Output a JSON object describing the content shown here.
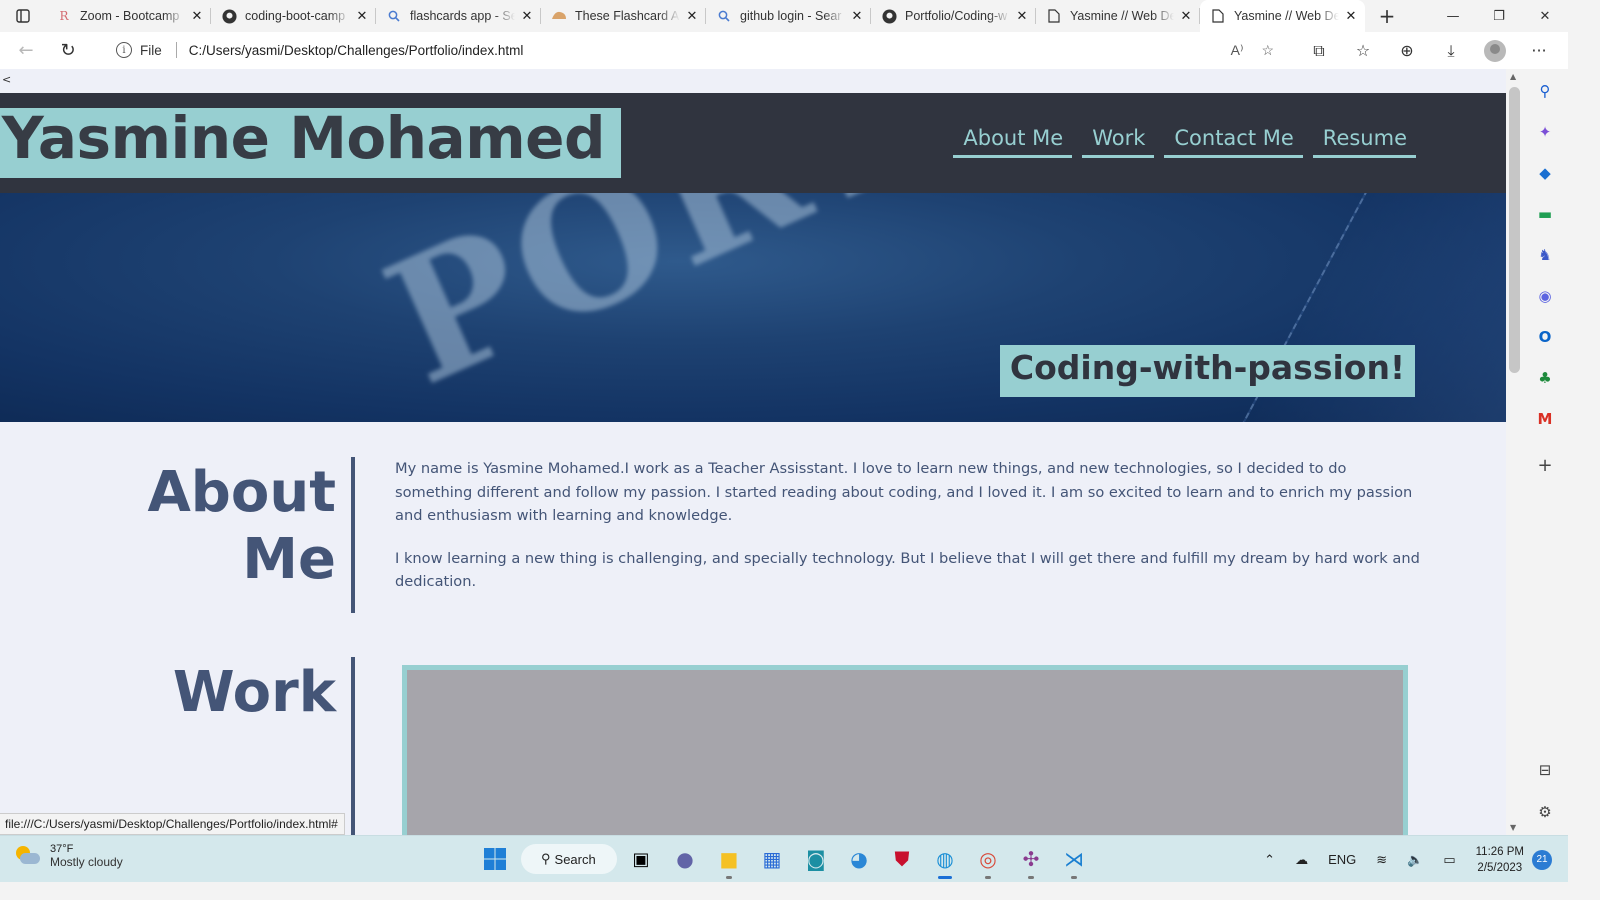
{
  "browser": {
    "tabs": [
      {
        "label": "Zoom - Bootcamp",
        "icon": "rss-icon"
      },
      {
        "label": "coding-boot-camp",
        "icon": "github-icon"
      },
      {
        "label": "flashcards app - Se",
        "icon": "search-icon"
      },
      {
        "label": "These Flashcard Ap",
        "icon": "site-icon"
      },
      {
        "label": "github login - Sear",
        "icon": "search-icon"
      },
      {
        "label": "Portfolio/Coding-w",
        "icon": "github-icon"
      },
      {
        "label": "Yasmine // Web De",
        "icon": "page-icon"
      },
      {
        "label": "Yasmine // Web De",
        "icon": "page-icon",
        "active": true
      }
    ],
    "address": {
      "scheme_label": "File",
      "url": "C:/Users/yasmi/Desktop/Challenges/Portfolio/index.html"
    },
    "status_url": "file:///C:/Users/yasmi/Desktop/Challenges/Portfolio/index.html#"
  },
  "site": {
    "caret": "<",
    "title": "Yasmine Mohamed",
    "nav": [
      "About Me",
      "Work",
      "Contact Me",
      "Resume"
    ],
    "hero": {
      "word": "PORTFO",
      "tagline": "Coding-with-passion!"
    },
    "about": {
      "heading": "About Me",
      "paragraphs": [
        "My name is Yasmine Mohamed.I work as a Teacher Assisstant. I love to learn new things, and new technologies, so I decided to do something different and follow my passion. I started reading about coding, and I loved it. I am so excited to learn and to enrich my passion and enthusiasm with learning and knowledge.",
        "I know learning a new thing is challenging, and specially technology. But I believe that I will get there and fulfill my dream by hard work and dedication."
      ]
    },
    "work": {
      "heading": "Work"
    },
    "colors": {
      "accent": "#97cfd1",
      "header_bg": "#30343f",
      "text": "#445577",
      "page_bg": "#eef0f8"
    }
  },
  "taskbar": {
    "weather": {
      "temp": "37°F",
      "desc": "Mostly cloudy"
    },
    "search_label": "Search",
    "tray": {
      "language": "ENG",
      "time": "11:26 PM",
      "date": "2/5/2023",
      "notifications": "21"
    }
  }
}
